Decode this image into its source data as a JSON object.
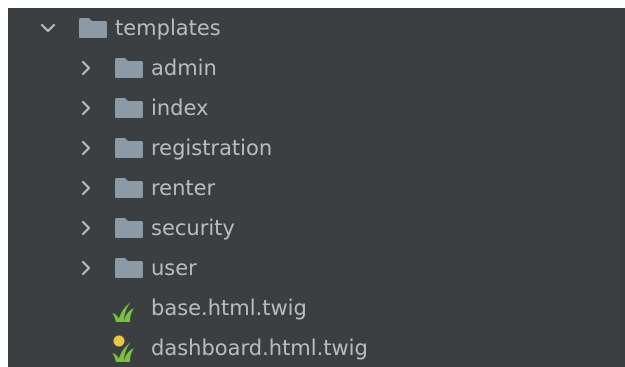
{
  "tree": {
    "root": {
      "label": "templates",
      "expanded": true,
      "icon": "folder-icon"
    },
    "folders": [
      {
        "label": "admin",
        "expanded": false,
        "icon": "folder-icon"
      },
      {
        "label": "index",
        "expanded": false,
        "icon": "folder-icon"
      },
      {
        "label": "registration",
        "expanded": false,
        "icon": "folder-icon"
      },
      {
        "label": "renter",
        "expanded": false,
        "icon": "folder-icon"
      },
      {
        "label": "security",
        "expanded": false,
        "icon": "folder-icon"
      },
      {
        "label": "user",
        "expanded": false,
        "icon": "folder-icon"
      }
    ],
    "files": [
      {
        "label": "base.html.twig",
        "icon": "twig-file-icon"
      },
      {
        "label": "dashboard.html.twig",
        "icon": "twig-file-modified-icon"
      }
    ]
  },
  "colors": {
    "background": "#3c3f41",
    "text": "#bbbbbb",
    "folder": "#8c9aa6",
    "chevron": "#b9bcbf",
    "twig_green": "#7bc043",
    "modified_dot": "#e8c74a"
  }
}
